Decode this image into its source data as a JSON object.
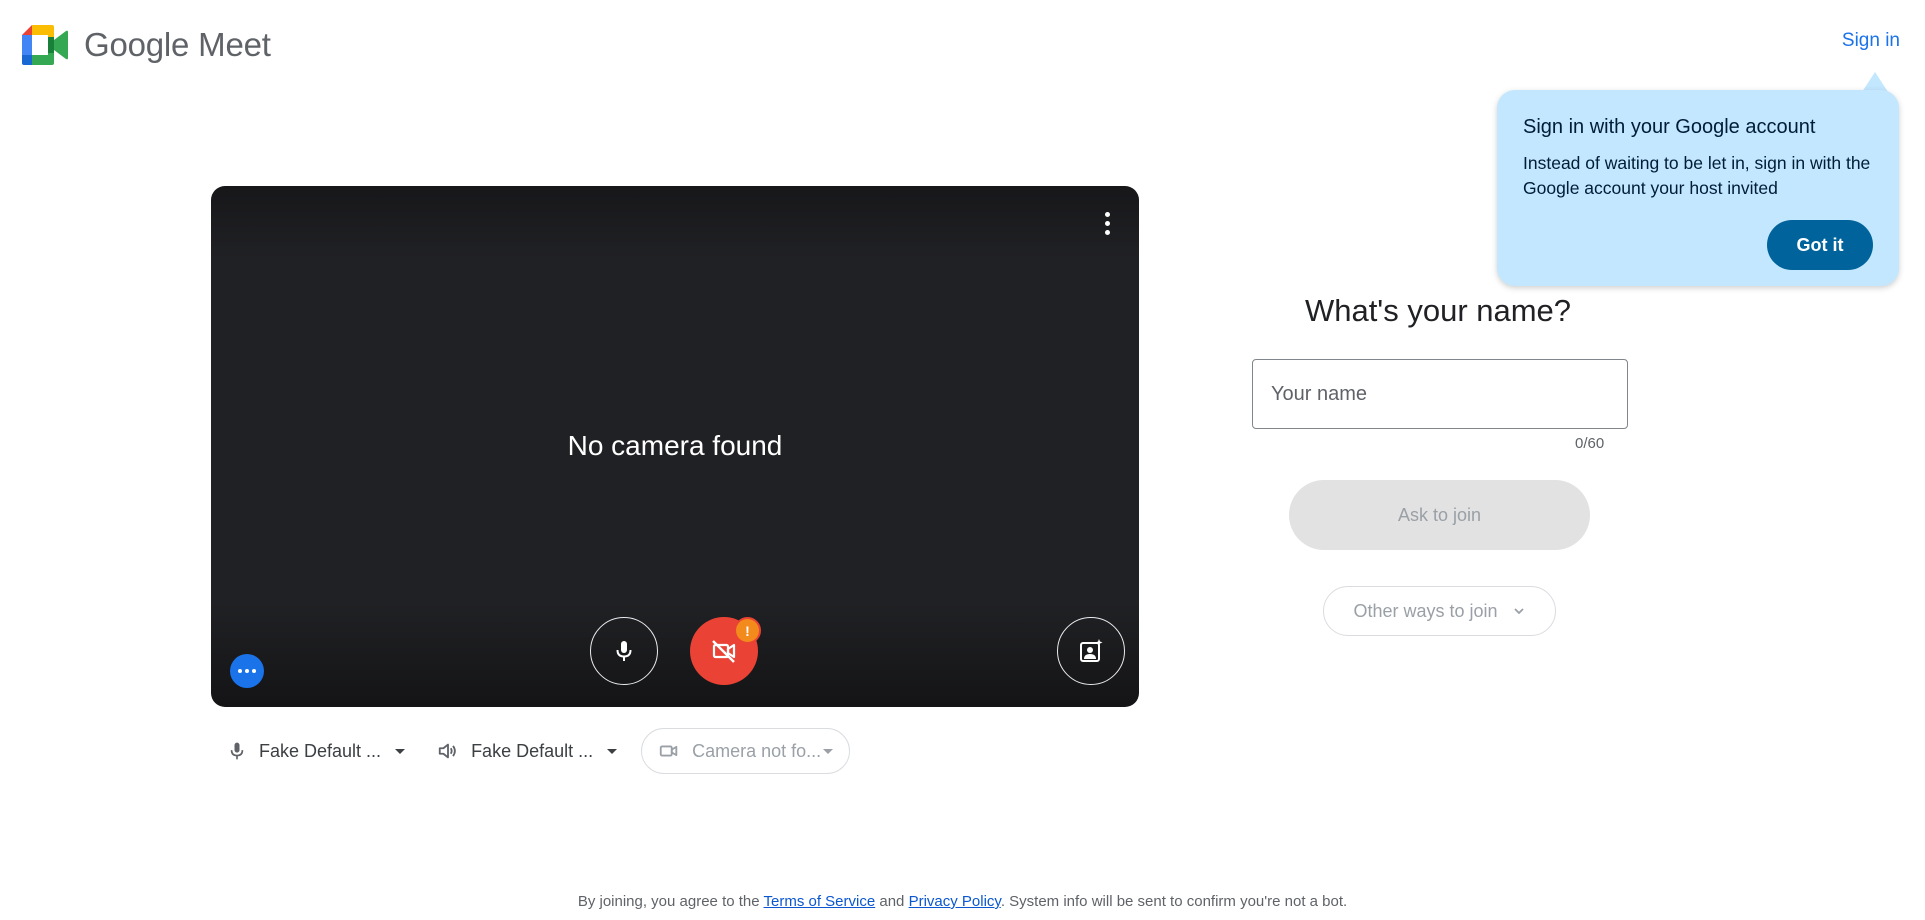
{
  "header": {
    "brand": "Google Meet",
    "sign_in": "Sign in"
  },
  "tooltip": {
    "title": "Sign in with your Google account",
    "body": "Instead of waiting to be let in, sign in with the Google account your host invited",
    "button": "Got it"
  },
  "preview": {
    "message": "No camera found",
    "warning_badge": "!"
  },
  "devices": {
    "microphone": "Fake Default ...",
    "speaker": "Fake Default ...",
    "camera": "Camera not fo..."
  },
  "join": {
    "title": "What's your name?",
    "name_placeholder": "Your name",
    "name_value": "",
    "counter": "0/60",
    "ask_button": "Ask to join",
    "other_ways": "Other ways to join"
  },
  "footer": {
    "prefix": "By joining, you agree to the ",
    "tos": "Terms of Service",
    "and": " and ",
    "privacy": "Privacy Policy",
    "suffix": ". System info will be sent to confirm you're not a bot."
  },
  "colors": {
    "accent": "#1a73e8",
    "tooltip_bg": "#c2e7ff",
    "camera_off": "#ea4335",
    "warning": "#f28b1c"
  },
  "icons": [
    "meet-logo-icon",
    "more-vert-icon",
    "mic-icon",
    "camera-off-icon",
    "visual-effects-icon",
    "more-horiz-icon",
    "speaker-icon",
    "videocam-icon",
    "chevron-down-icon"
  ]
}
